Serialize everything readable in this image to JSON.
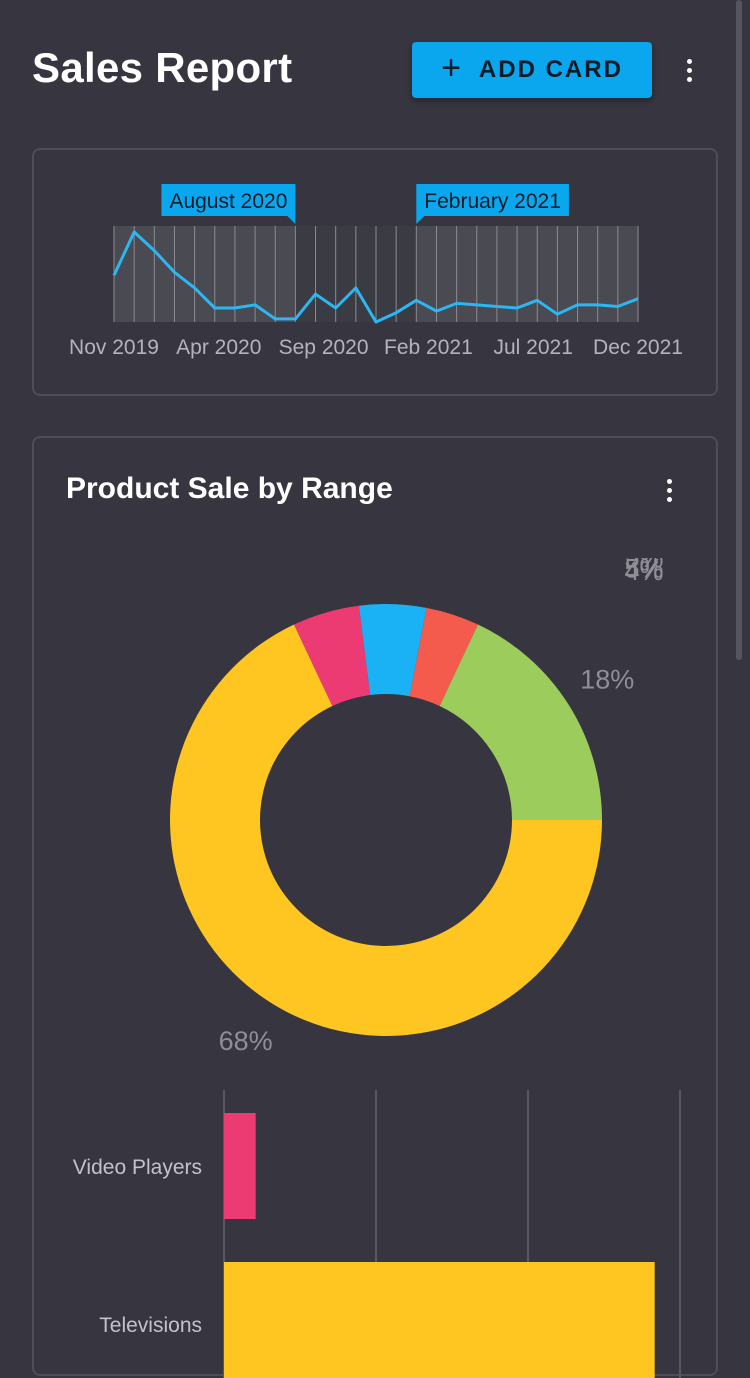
{
  "header": {
    "title": "Sales Report",
    "add_label": "ADD CARD"
  },
  "timeline": {
    "range_start_label": "August 2020",
    "range_end_label": "February 2021",
    "axis_labels": [
      "Nov 2019",
      "Apr 2020",
      "Sep 2020",
      "Feb 2021",
      "Jul 2021",
      "Dec 2021"
    ],
    "line_color": "#2cb6f2",
    "values": [
      30,
      58,
      46,
      32,
      22,
      9,
      9,
      11,
      2,
      2,
      18,
      9,
      22,
      0,
      6,
      14,
      7,
      12,
      11,
      10,
      9,
      14,
      5,
      11,
      11,
      10,
      15
    ]
  },
  "product_card": {
    "title": "Product Sale by Range"
  },
  "chart_data": [
    {
      "type": "pie",
      "title": "",
      "slices": [
        {
          "value": 68,
          "label": "68%",
          "color": "#ffc520"
        },
        {
          "value": 5,
          "label": "5%",
          "color": "#ec3a73"
        },
        {
          "value": 5,
          "label": "5%",
          "color": "#1ab2f4"
        },
        {
          "value": 4,
          "label": "4%",
          "color": "#f55b4c"
        },
        {
          "value": 18,
          "label": "18%",
          "color": "#9ccc5c"
        }
      ]
    },
    {
      "type": "bar",
      "orientation": "horizontal",
      "categories": [
        "Video Players",
        "Televisions"
      ],
      "values": [
        5,
        68
      ],
      "colors": [
        "#ec3a73",
        "#ffc520"
      ],
      "xlim": [
        0,
        72
      ]
    }
  ]
}
